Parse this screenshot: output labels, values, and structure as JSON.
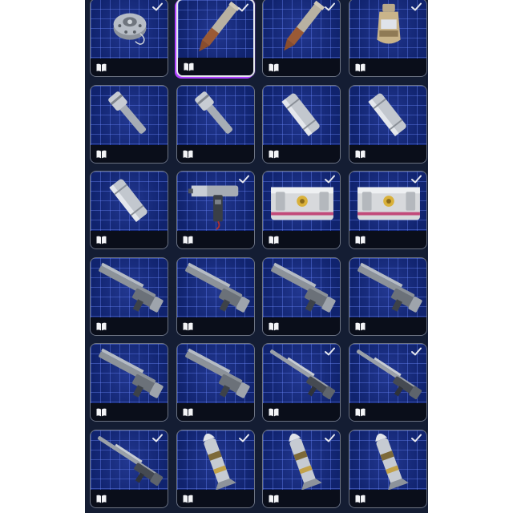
{
  "items": [
    {
      "icon": "landmine-icon",
      "checked": true,
      "selected": false
    },
    {
      "icon": "shell-cartridge-icon",
      "checked": true,
      "selected": true
    },
    {
      "icon": "shell-cartridge-icon",
      "checked": true,
      "selected": false
    },
    {
      "icon": "bottle-icon",
      "checked": true,
      "selected": false
    },
    {
      "icon": "grenade-icon",
      "checked": false,
      "selected": false
    },
    {
      "icon": "grenade-icon",
      "checked": false,
      "selected": false
    },
    {
      "icon": "canister-icon",
      "checked": false,
      "selected": false
    },
    {
      "icon": "canister-icon",
      "checked": false,
      "selected": false
    },
    {
      "icon": "canister-icon",
      "checked": false,
      "selected": false
    },
    {
      "icon": "pistol-icon",
      "checked": true,
      "selected": false
    },
    {
      "icon": "supply-crate-icon",
      "checked": true,
      "selected": false
    },
    {
      "icon": "supply-crate-icon",
      "checked": true,
      "selected": false
    },
    {
      "icon": "rifle-icon",
      "checked": false,
      "selected": false
    },
    {
      "icon": "rifle-icon",
      "checked": false,
      "selected": false
    },
    {
      "icon": "rifle-icon",
      "checked": false,
      "selected": false
    },
    {
      "icon": "rifle-icon",
      "checked": false,
      "selected": false
    },
    {
      "icon": "rifle-icon",
      "checked": false,
      "selected": false
    },
    {
      "icon": "rifle-icon",
      "checked": false,
      "selected": false
    },
    {
      "icon": "long-rifle-icon",
      "checked": true,
      "selected": false
    },
    {
      "icon": "long-rifle-icon",
      "checked": true,
      "selected": false
    },
    {
      "icon": "long-rifle-icon",
      "checked": true,
      "selected": false
    },
    {
      "icon": "missile-icon",
      "checked": true,
      "selected": false
    },
    {
      "icon": "missile-icon",
      "checked": true,
      "selected": false
    },
    {
      "icon": "missile-icon",
      "checked": true,
      "selected": false
    }
  ],
  "colors": {
    "panel": "#141d33",
    "tile_bg": "#10236e",
    "grid_line": "#6e8cff",
    "selected_glow": "#b040ff",
    "check": "#e6e8ef"
  }
}
